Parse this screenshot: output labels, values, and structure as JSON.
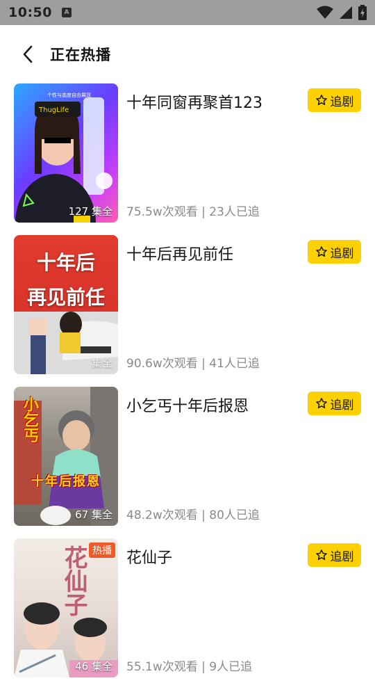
{
  "status_bar": {
    "time": "10:50",
    "app_indicator": "A"
  },
  "header": {
    "back_icon": "chevron-left-icon",
    "title": "正在热播"
  },
  "items": [
    {
      "title": "十年同窗再聚首123",
      "episodes": "127 集全",
      "meta": "75.5w次观看 | 23人已追",
      "follow_label": "追剧",
      "thumb_caption": "个性与态度自由展现",
      "badge": ""
    },
    {
      "title": "十年后再见前任",
      "episodes": "集全",
      "meta": "90.6w次观看 | 41人已追",
      "follow_label": "追剧",
      "thumb_line1": "十年后",
      "thumb_line2": "再见前任",
      "badge": ""
    },
    {
      "title": "小乞丐十年后报恩",
      "episodes": "67 集全",
      "meta": "48.2w次观看 | 80人已追",
      "follow_label": "追剧",
      "thumb_vertical": "小乞丐",
      "thumb_horizontal": "十年后报恩",
      "badge": ""
    },
    {
      "title": "花仙子",
      "episodes": "46 集全",
      "meta": "55.1w次观看 | 9人已追",
      "follow_label": "追剧",
      "badge": "热播",
      "thumb_calligraphy": "花仙子"
    }
  ],
  "colors": {
    "accent": "#fdd000",
    "status_bar": "#9e9e9e",
    "meta_text": "#8a8a8a"
  }
}
